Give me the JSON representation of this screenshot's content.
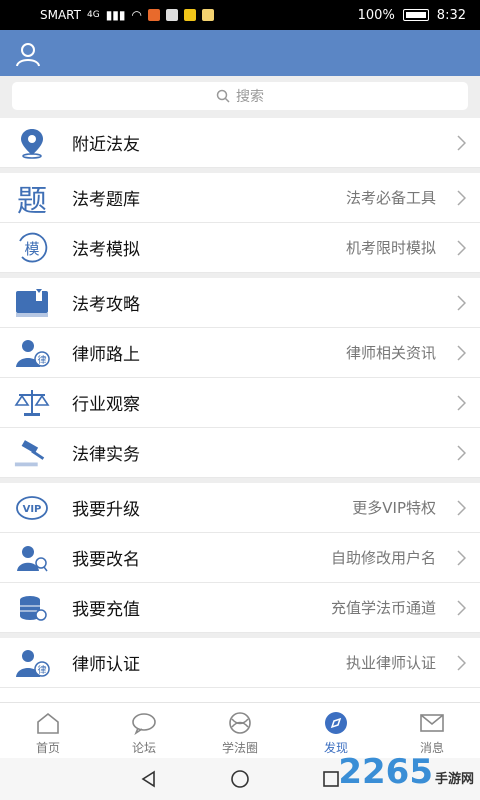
{
  "status": {
    "carrier": "SMART",
    "net": "4G",
    "battery": "100%",
    "time": "8:32"
  },
  "search": {
    "placeholder": "搜索"
  },
  "groups": [
    [
      {
        "label": "附近法友",
        "sub": "",
        "icon": "location-pin-icon"
      }
    ],
    [
      {
        "label": "法考题库",
        "sub": "法考必备工具",
        "icon": "ti-character-icon"
      },
      {
        "label": "法考模拟",
        "sub": "机考限时模拟",
        "icon": "mo-character-icon"
      }
    ],
    [
      {
        "label": "法考攻略",
        "sub": "",
        "icon": "book-icon"
      },
      {
        "label": "律师路上",
        "sub": "律师相关资讯",
        "icon": "lawyer-icon"
      },
      {
        "label": "行业观察",
        "sub": "",
        "icon": "scales-icon"
      },
      {
        "label": "法律实务",
        "sub": "",
        "icon": "gavel-icon"
      }
    ],
    [
      {
        "label": "我要升级",
        "sub": "更多VIP特权",
        "icon": "vip-icon"
      },
      {
        "label": "我要改名",
        "sub": "自助修改用户名",
        "icon": "rename-user-icon"
      },
      {
        "label": "我要充值",
        "sub": "充值学法币通道",
        "icon": "coin-stack-icon"
      }
    ],
    [
      {
        "label": "律师认证",
        "sub": "执业律师认证",
        "icon": "lawyer-certify-icon"
      }
    ]
  ],
  "tabs": [
    {
      "label": "首页",
      "icon": "home-icon",
      "active": false
    },
    {
      "label": "论坛",
      "icon": "chat-bubble-icon",
      "active": false
    },
    {
      "label": "学法圈",
      "icon": "circle-network-icon",
      "active": false
    },
    {
      "label": "发现",
      "icon": "compass-icon",
      "active": true
    },
    {
      "label": "消息",
      "icon": "mail-icon",
      "active": false
    }
  ],
  "watermark": {
    "text": "2265",
    "sub": "手游网"
  },
  "colors": {
    "header": "#5b86c5",
    "accent": "#3c6fc1"
  }
}
